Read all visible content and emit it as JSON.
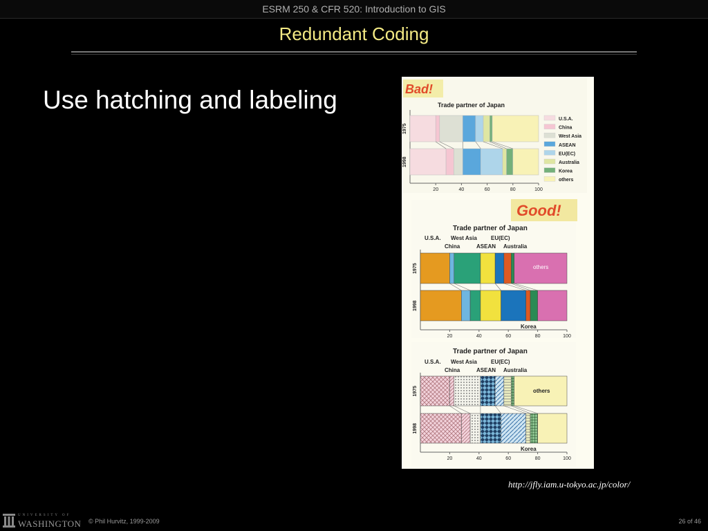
{
  "header": {
    "course_title": "ESRM 250 & CFR 520: Introduction to GIS",
    "slide_title": "Redundant Coding"
  },
  "body": {
    "bullet": "Use hatching and labeling"
  },
  "figure": {
    "bad_label": "Bad!",
    "good_label": "Good!",
    "chart_title": "Trade partner of Japan",
    "years": [
      "1975",
      "1998"
    ],
    "x_ticks": [
      "20",
      "40",
      "60",
      "80",
      "100"
    ],
    "legend": [
      {
        "name": "U.S.A.",
        "color": "#f6dce0"
      },
      {
        "name": "China",
        "color": "#f5c6d2"
      },
      {
        "name": "West Asia",
        "color": "#dde0d4"
      },
      {
        "name": "ASEAN",
        "color": "#5aa7dc"
      },
      {
        "name": "EU(EC)",
        "color": "#aed5ea"
      },
      {
        "name": "Australia",
        "color": "#dfe6a2"
      },
      {
        "name": "Korea",
        "color": "#74b07a"
      },
      {
        "name": "others",
        "color": "#f8f2b6"
      }
    ],
    "good_colors": [
      "#e59a20",
      "#6fb6df",
      "#2aa178",
      "#f1e13e",
      "#1b74bb",
      "#dd5a22",
      "#2a8a54",
      "#d970b0"
    ],
    "top_labels_row1": [
      "U.S.A.",
      "West Asia",
      "EU(EC)"
    ],
    "top_labels_row2": [
      "China",
      "ASEAN",
      "Australia"
    ],
    "others_label": "others",
    "korea_label": "Korea"
  },
  "chart_data": [
    {
      "type": "bar",
      "title": "Trade partner of Japan",
      "categories": [
        "1975",
        "1998"
      ],
      "xlim": [
        0,
        100
      ],
      "series": [
        {
          "name": "U.S.A.",
          "values": [
            20,
            28
          ]
        },
        {
          "name": "China",
          "values": [
            3,
            6
          ]
        },
        {
          "name": "West Asia",
          "values": [
            18,
            7
          ]
        },
        {
          "name": "ASEAN",
          "values": [
            10,
            14
          ]
        },
        {
          "name": "EU(EC)",
          "values": [
            6,
            17
          ]
        },
        {
          "name": "Australia",
          "values": [
            5,
            3
          ]
        },
        {
          "name": "Korea",
          "values": [
            2,
            5
          ]
        },
        {
          "name": "others",
          "values": [
            36,
            20
          ]
        }
      ]
    }
  ],
  "source_url": "http://jfly.iam.u-tokyo.ac.jp/color/",
  "footer": {
    "logo_small": "UNIVERSITY OF",
    "logo_big": "WASHINGTON",
    "copyright": "© Phil Hurvitz, 1999-2009",
    "page": "26 of 46"
  }
}
